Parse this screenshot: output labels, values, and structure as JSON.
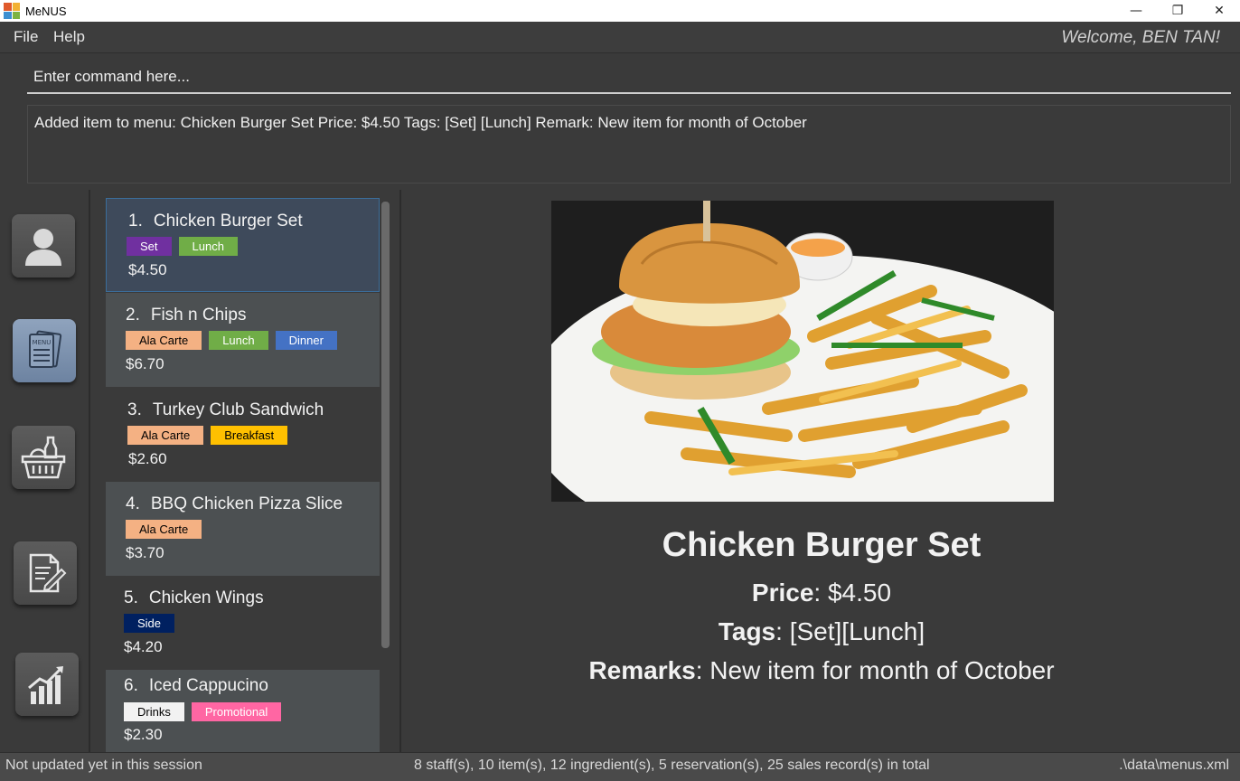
{
  "window": {
    "title": "MeNUS",
    "minimize_glyph": "—",
    "restore_glyph": "❐",
    "close_glyph": "✕"
  },
  "menubar": {
    "file": "File",
    "help": "Help",
    "welcome": "Welcome, BEN TAN!"
  },
  "command": {
    "placeholder": "Enter command here..."
  },
  "result": {
    "text": "Added item to menu: Chicken Burger Set Price: $4.50 Tags: [Set] [Lunch] Remark: New item for month of October"
  },
  "sidebar": {
    "items": [
      {
        "icon": "staff-icon",
        "active": false
      },
      {
        "icon": "menu-icon",
        "active": true
      },
      {
        "icon": "ingredients-basket-icon",
        "active": false
      },
      {
        "icon": "reservation-notepad-icon",
        "active": false
      },
      {
        "icon": "sales-chart-icon",
        "active": false
      }
    ]
  },
  "items": [
    {
      "index": "1.",
      "name": "Chicken Burger Set",
      "price": "$4.50",
      "tags": [
        {
          "label": "Set",
          "bg": "#7030a0",
          "fg": "#ffffff"
        },
        {
          "label": "Lunch",
          "bg": "#70ad47",
          "fg": "#ffffff"
        }
      ]
    },
    {
      "index": "2.",
      "name": "Fish n Chips",
      "price": "$6.70",
      "tags": [
        {
          "label": "Ala Carte",
          "bg": "#f4b183",
          "fg": "#000000"
        },
        {
          "label": "Lunch",
          "bg": "#70ad47",
          "fg": "#ffffff"
        },
        {
          "label": "Dinner",
          "bg": "#4472c4",
          "fg": "#ffffff"
        }
      ]
    },
    {
      "index": "3.",
      "name": "Turkey Club Sandwich",
      "price": "$2.60",
      "tags": [
        {
          "label": "Ala Carte",
          "bg": "#f4b183",
          "fg": "#000000"
        },
        {
          "label": "Breakfast",
          "bg": "#ffc000",
          "fg": "#000000"
        }
      ]
    },
    {
      "index": "4.",
      "name": "BBQ Chicken Pizza Slice",
      "price": "$3.70",
      "tags": [
        {
          "label": "Ala Carte",
          "bg": "#f4b183",
          "fg": "#000000"
        }
      ]
    },
    {
      "index": "5.",
      "name": "Chicken Wings",
      "price": "$4.20",
      "tags": [
        {
          "label": "Side",
          "bg": "#002060",
          "fg": "#ffffff"
        }
      ]
    },
    {
      "index": "6.",
      "name": "Iced Cappucino",
      "price": "$2.30",
      "tags": [
        {
          "label": "Drinks",
          "bg": "#f2f2f2",
          "fg": "#000000"
        },
        {
          "label": "Promotional",
          "bg": "#ff66a3",
          "fg": "#ffffff"
        }
      ]
    }
  ],
  "detail": {
    "name": "Chicken Burger Set",
    "price_label": "Price",
    "price_value": ": $4.50",
    "tags_label": "Tags",
    "tags_value": ": [Set][Lunch]",
    "remarks_label": "Remarks",
    "remarks_value": ": New item for month of October",
    "image_icon": "chicken-burger-photo"
  },
  "status": {
    "left": "Not updated yet in this session",
    "middle": "8 staff(s), 10 item(s), 12 ingredient(s), 5 reservation(s), 25 sales record(s) in total",
    "right": ".\\data\\menus.xml"
  }
}
